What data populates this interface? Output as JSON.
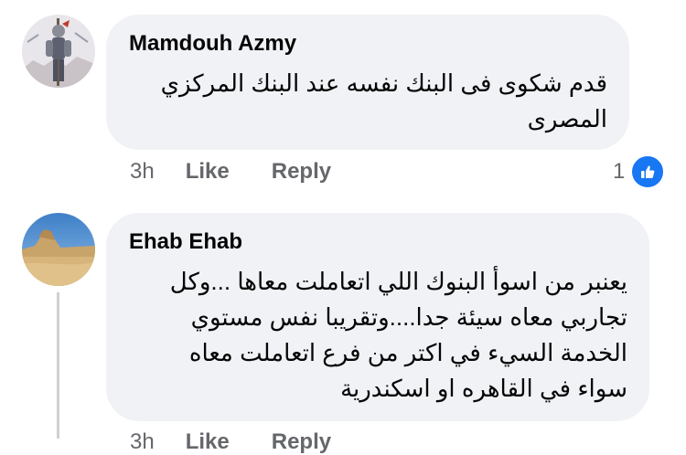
{
  "comments": [
    {
      "author": "Mamdouh Azmy",
      "lines": [
        "قدم شكوى فى البنك نفسه عند البنك المركزي",
        "المصرى"
      ],
      "time": "3h",
      "like_label": "Like",
      "reply_label": "Reply",
      "reaction_count": "1",
      "avatar_icon": "knight-armor-avatar"
    },
    {
      "author": "Ehab Ehab",
      "lines": [
        "يعنبر من اسوأ البنوك اللي اتعاملت معاها ...وكل",
        "تجاربي معاه سيئة جدا....وتقريبا نفس مستوي",
        "الخدمة السيء في اكتر من فرع اتعاملت معاه",
        "سواء في القاهره او اسكندرية"
      ],
      "time": "3h",
      "like_label": "Like",
      "reply_label": "Reply",
      "avatar_icon": "desert-landscape-avatar"
    }
  ],
  "colors": {
    "bubble": "#f0f2f5",
    "secondary_text": "#65676b",
    "like_blue": "#1877f2"
  }
}
